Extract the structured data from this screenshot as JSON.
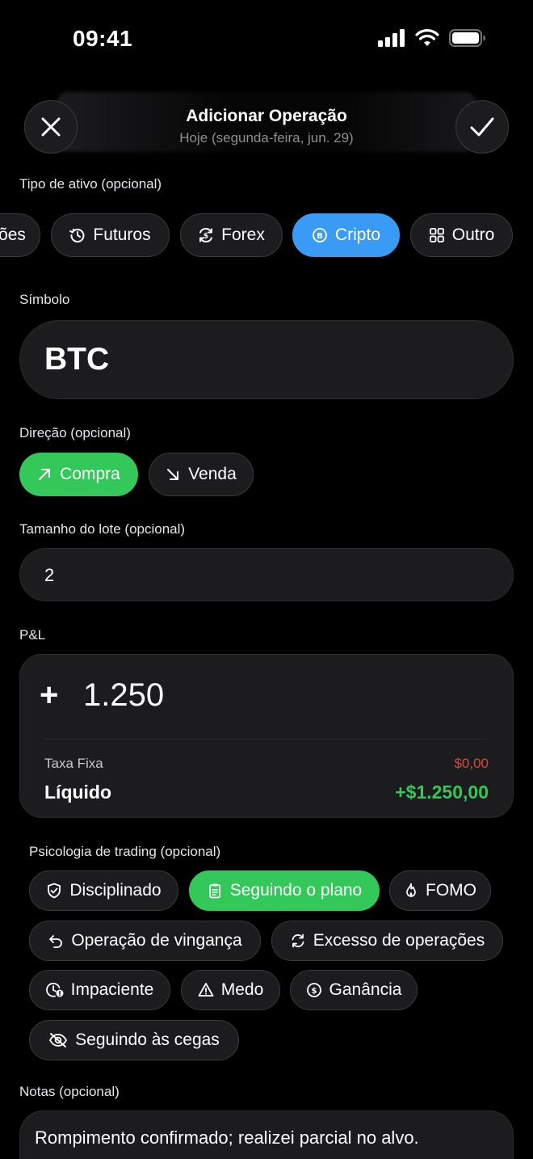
{
  "status_bar": {
    "time": "09:41"
  },
  "header": {
    "title": "Adicionar Operação",
    "subtitle": "Hoje (segunda-feira, jun. 29)"
  },
  "asset_type": {
    "label": "Tipo de ativo (opcional)",
    "options": [
      {
        "label": "ões",
        "icon": "none",
        "active": false
      },
      {
        "label": "Futuros",
        "icon": "history-icon",
        "active": false
      },
      {
        "label": "Forex",
        "icon": "dollar-exchange-icon",
        "active": false
      },
      {
        "label": "Cripto",
        "icon": "bitcoin-icon",
        "active": true
      },
      {
        "label": "Outro",
        "icon": "grid-icon",
        "active": false
      }
    ],
    "active_color": "#3a9bf5"
  },
  "symbol": {
    "label": "Símbolo",
    "value": "BTC"
  },
  "direction": {
    "label": "Direção (opcional)",
    "buy_label": "Compra",
    "sell_label": "Venda",
    "selected": "Compra",
    "active_color": "#34c759"
  },
  "lot_size": {
    "label": "Tamanho do lote (opcional)",
    "value": "2"
  },
  "pnl": {
    "label": "P&L",
    "sign": "+",
    "value": "1.250",
    "fee_label": "Taxa Fixa",
    "fee_value": "$0,00",
    "net_label": "Líquido",
    "net_value": "+$1.250,00",
    "fee_color": "#e0453a",
    "net_color": "#34c759"
  },
  "psychology": {
    "label": "Psicologia de trading (opcional)",
    "tags": [
      {
        "label": "Disciplinado",
        "icon": "shield-check-icon",
        "active": false
      },
      {
        "label": "Seguindo o plano",
        "icon": "clipboard-icon",
        "active": true
      },
      {
        "label": "FOMO",
        "icon": "flame-icon",
        "active": false
      },
      {
        "label": "Operação de vingança",
        "icon": "undo-arrow-icon",
        "active": false
      },
      {
        "label": "Excesso de operações",
        "icon": "refresh-icon",
        "active": false
      },
      {
        "label": "Impaciente",
        "icon": "clock-alert-icon",
        "active": false
      },
      {
        "label": "Medo",
        "icon": "warning-triangle-icon",
        "active": false
      },
      {
        "label": "Ganância",
        "icon": "dollar-circle-icon",
        "active": false
      },
      {
        "label": "Seguindo às cegas",
        "icon": "eye-off-icon",
        "active": false
      }
    ]
  },
  "notes": {
    "label": "Notas (opcional)",
    "value": "Rompimento confirmado; realizei parcial no alvo."
  }
}
